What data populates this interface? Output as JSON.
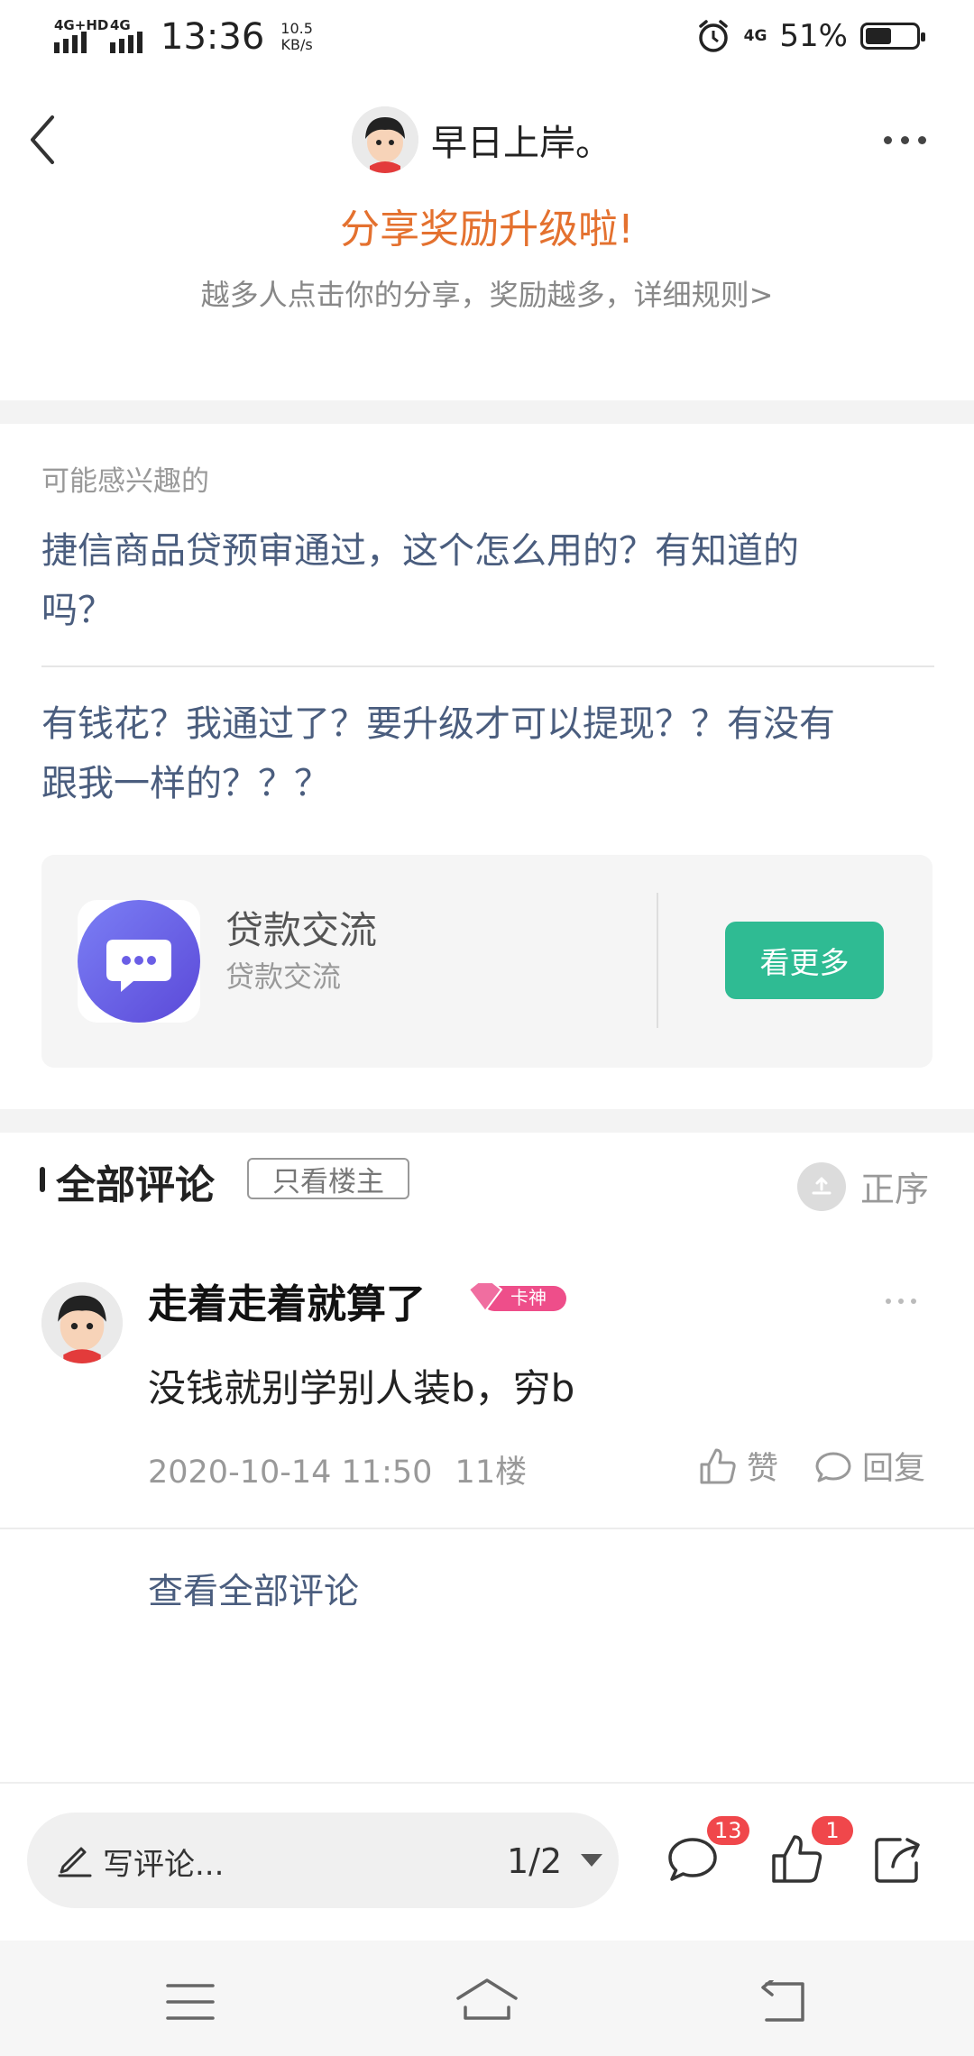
{
  "status_bar": {
    "net1": "4G+HD",
    "net2": "4G",
    "time": "13:36",
    "speed_value": "10.5",
    "speed_unit": "KB/s",
    "net3": "4G",
    "battery_text": "51%",
    "battery_level": 0.51
  },
  "header": {
    "author_name": "早日上岸。",
    "share_title": "分享奖励升级啦!",
    "share_subtitle": "越多人点击你的分享，奖励越多，详细规则>"
  },
  "interest": {
    "heading": "可能感兴趣的",
    "items": [
      {
        "line1": "捷信商品贷预审通过，这个怎么用的？有知道的",
        "line2": "吗？"
      },
      {
        "line1": "有钱花？我通过了？要升级才可以提现？？有没有",
        "line2": "跟我一样的？？？"
      }
    ]
  },
  "forum_card": {
    "name": "贷款交流",
    "subtitle": "贷款交流",
    "button": "看更多"
  },
  "comments": {
    "title": "全部评论",
    "only_host": "只看楼主",
    "order": "正序",
    "items": [
      {
        "user": "走着走着就算了",
        "badge": "卡神",
        "text": "没钱就别学别人装b，穷b",
        "time": "2020-10-14 11:50",
        "floor": "11楼",
        "like": "赞",
        "reply": "回复"
      }
    ],
    "view_all": "查看全部评论"
  },
  "bottom_bar": {
    "write_placeholder": "写评论...",
    "page_indicator": "1/2",
    "comment_count": "13",
    "like_count": "1"
  },
  "icons": {
    "back": "back-arrow-icon",
    "more": "more-dots-icon",
    "order": "sort-icon",
    "like": "thumb-up-icon",
    "reply": "chat-bubble-icon",
    "share": "share-icon",
    "pen": "pen-icon"
  },
  "colors": {
    "accent_orange": "#e4712f",
    "link_blue": "#4a5d7e",
    "green_button": "#2fbb93",
    "badge_red": "#f0474b",
    "badge_pink": "#ee4e8a"
  }
}
